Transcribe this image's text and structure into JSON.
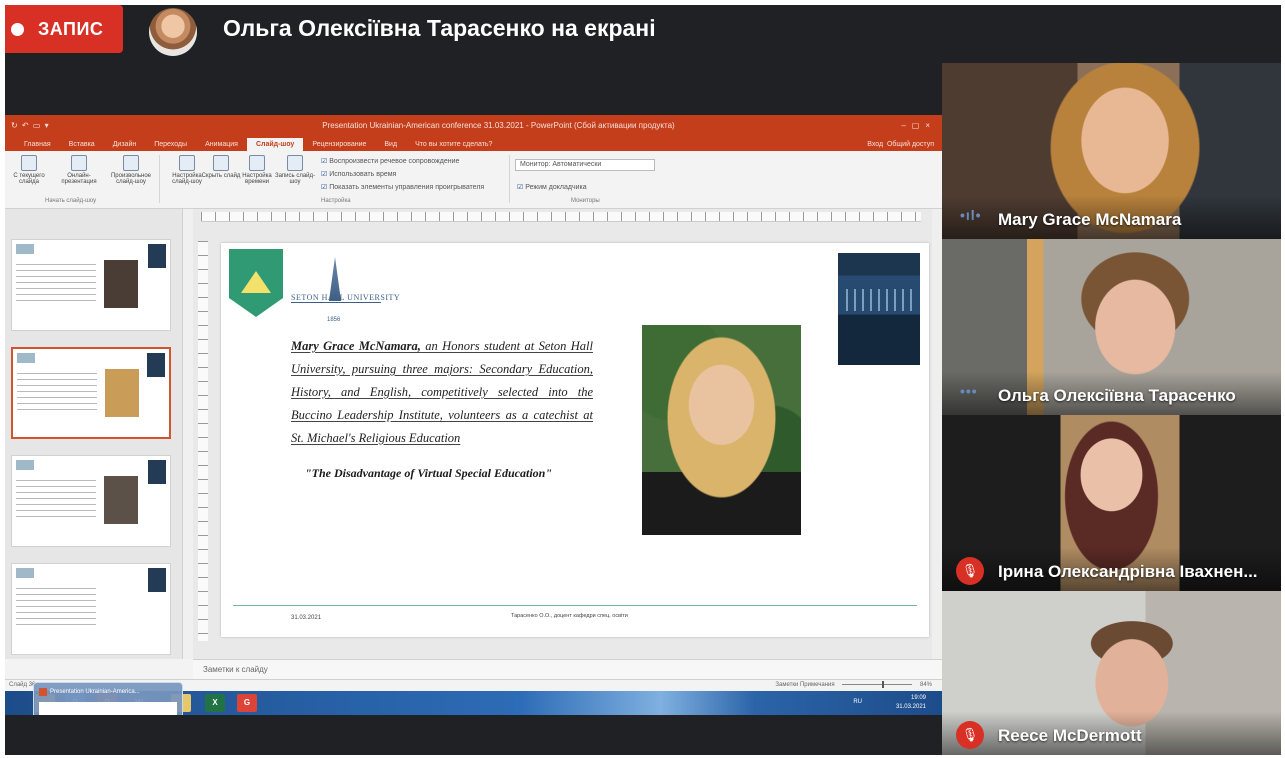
{
  "meet": {
    "recording_label": "ЗАПИС",
    "presenter_title": "Ольга Олексіївна Тарасенко на екрані"
  },
  "powerpoint": {
    "window_title": "Presentation Ukrainian-American conference 31.03.2021 - PowerPoint (Сбой активации продукта)",
    "tabs": [
      "Главная",
      "Вставка",
      "Дизайн",
      "Переходы",
      "Анимация",
      "Слайд-шоу",
      "Рецензирование",
      "Вид"
    ],
    "active_tab": "Слайд-шоу",
    "tell_me": "Что вы хотите сделать?",
    "signin": "Вход",
    "share": "Общий доступ",
    "ribbon": {
      "buttons": [
        "С текущего слайда",
        "Онлайн-презентация",
        "Произвольное слайд-шоу",
        "Настройка слайд-шоу",
        "Скрыть слайд",
        "Настройка времени",
        "Запись слайд-шоу"
      ],
      "checks": [
        "Воспроизвести речевое сопровождение",
        "Использовать время",
        "Показать элементы управления проигрывателя"
      ],
      "group_start": "Начать слайд-шоу",
      "group_setup": "Настройка",
      "group_monitors": "Мониторы",
      "monitor_value": "Монитор: Автоматически",
      "presenter_view": "Режим докладчика"
    },
    "notes_placeholder": "Заметки к слайду",
    "status_slide": "Слайд 36",
    "status_right": "Заметки   Примечания",
    "zoom": "84%"
  },
  "slide": {
    "univ_wordmark": "SETON HALL UNIVERSITY",
    "univ_year": "1856",
    "speaker_name": "Mary Grace McNamara,",
    "bio": " an Honors student at Seton Hall University, pursuing three majors: Secondary Education, History, and English, competitively selected into the Buccino Leadership Institute, volunteers as a catechist at St. Michael's Religious Education",
    "talk_title": "\"The Disadvantage of Virtual Special Education\"",
    "date": "31.03.2021",
    "footer": "Тарасенко О.О., доцент кафедри спец. освіти"
  },
  "preview": {
    "title": "Presentation Ukrainian-America..."
  },
  "taskbar": {
    "lang": "RU",
    "time": "19:09",
    "date": "31.03.2021"
  },
  "participants": [
    {
      "name": "Mary Grace McNamara",
      "status": "speaking"
    },
    {
      "name": "Ольга Олексіївна Тарасенко",
      "status": "speaking"
    },
    {
      "name": "Ірина Олександрівна Івахнен...",
      "status": "muted"
    },
    {
      "name": "Reece McDermott",
      "status": "muted"
    }
  ]
}
